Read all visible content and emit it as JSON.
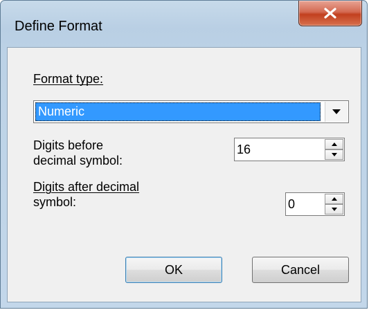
{
  "window": {
    "title": "Define Format",
    "close_glyph": "X"
  },
  "form": {
    "format_type_label": "Format type:",
    "format_type_value": "Numeric",
    "digits_before_label_line1": "Digits before",
    "digits_before_label_line2": "decimal symbol:",
    "digits_before_value": "16",
    "digits_after_label_line1": "Digits after decimal",
    "digits_after_label_line2": "symbol:",
    "digits_after_value": "0"
  },
  "buttons": {
    "ok_label": "OK",
    "cancel_label": "Cancel"
  },
  "colors": {
    "selection": "#3399ff",
    "close_button": "#c2401f"
  },
  "icons": {
    "close": "close-icon",
    "dropdown": "chevron-down-icon",
    "spin_up": "spin-up-icon",
    "spin_down": "spin-down-icon"
  }
}
